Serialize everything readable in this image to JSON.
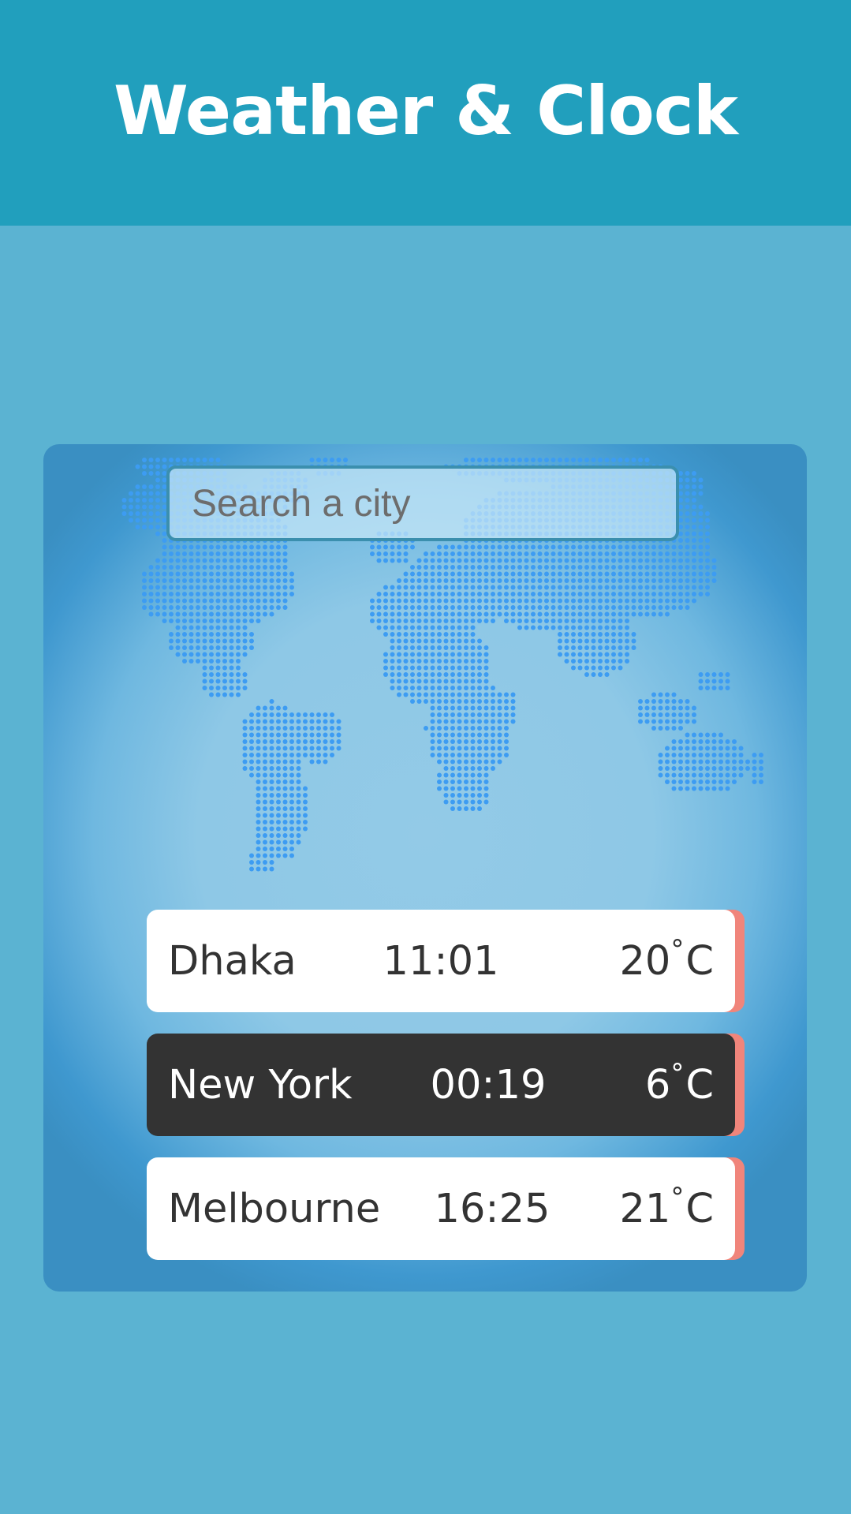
{
  "header": {
    "title": "Weather & Clock"
  },
  "search": {
    "placeholder": "Search a city",
    "value": ""
  },
  "cities": [
    {
      "name": "Dhaka",
      "time": "11:01",
      "temp": "20",
      "unit": "C",
      "selected": false
    },
    {
      "name": "New York",
      "time": "00:19",
      "temp": "6",
      "unit": "C",
      "selected": true
    },
    {
      "name": "Melbourne",
      "time": "16:25",
      "temp": "21",
      "unit": "C",
      "selected": false
    }
  ],
  "symbols": {
    "degree": "°"
  },
  "colors": {
    "header_bg": "#219fbd",
    "page_bg": "#5bb3d2",
    "map_dot": "#3d9cf2",
    "row_accent": "#f0857b",
    "row_selected_bg": "#333333",
    "row_bg": "#ffffff"
  },
  "map": {
    "icon": "world-map-dotted"
  }
}
